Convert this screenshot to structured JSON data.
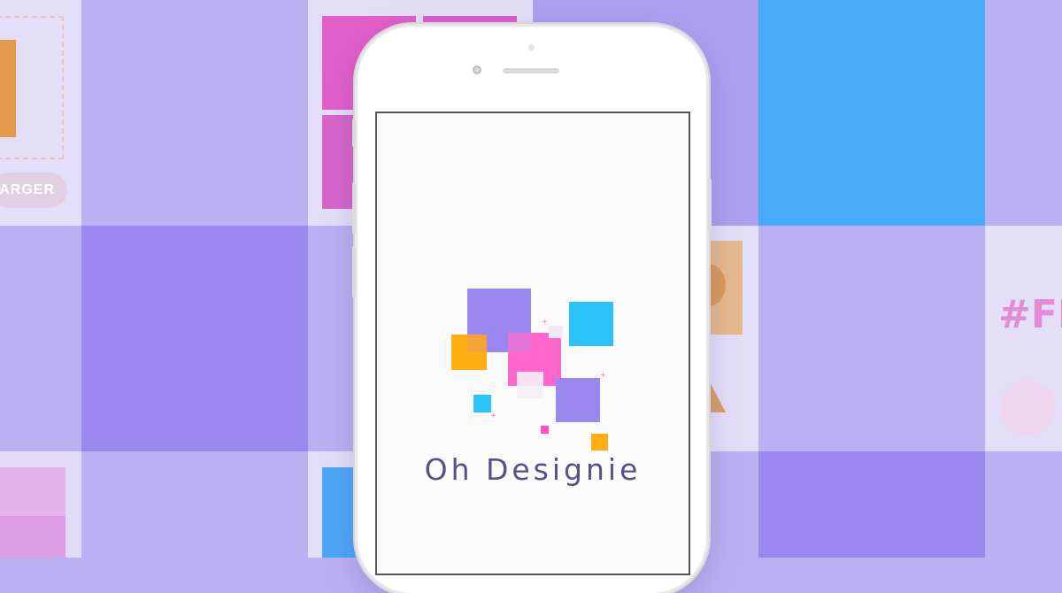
{
  "app": {
    "name": "Oh Designie"
  },
  "background": {
    "pill_text": "ARGER",
    "hex_text": "#FI"
  },
  "colors": {
    "background_lavender": "#bbb0f2",
    "accent_purple": "#9b88ef",
    "accent_blue": "#49aaf9",
    "accent_pink": "#ff66cc",
    "accent_orange": "#ffad12",
    "accent_cyan": "#2cc4f8",
    "brand_text": "#5b4f86"
  }
}
